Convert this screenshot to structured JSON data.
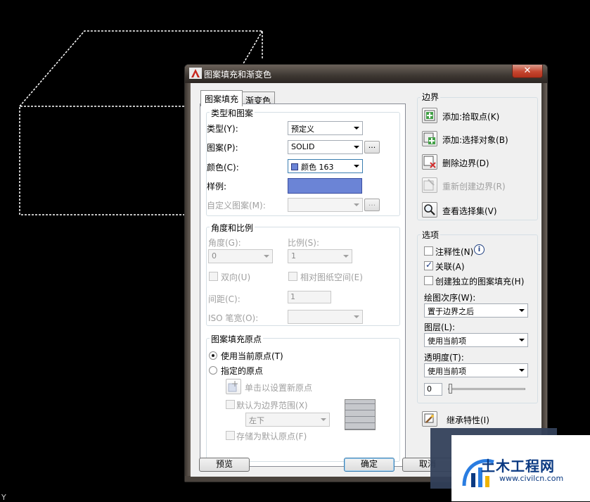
{
  "dialog": {
    "title": "图案填充和渐变色",
    "close_glyph": "✕",
    "tabs": [
      {
        "label": "图案填充",
        "active": true
      },
      {
        "label": "渐变色",
        "active": false
      }
    ],
    "type_pattern": {
      "legend": "类型和图案",
      "type_label": "类型(Y):",
      "type_value": "预定义",
      "pattern_label": "图案(P):",
      "pattern_value": "SOLID",
      "color_label": "颜色(C):",
      "color_value": "颜色 163",
      "sample_label": "样例:",
      "custom_label": "自定义图案(M):",
      "dots": "..."
    },
    "angle_scale": {
      "legend": "角度和比例",
      "angle_label": "角度(G):",
      "angle_value": "0",
      "scale_label": "比例(S):",
      "scale_value": "1",
      "double_label": "双向(U)",
      "relative_label": "相对图纸空间(E)",
      "spacing_label": "间距(C):",
      "spacing_value": "1",
      "iso_label": "ISO 笔宽(O):"
    },
    "origin": {
      "legend": "图案填充原点",
      "use_current_label": "使用当前原点(T)",
      "specified_label": "指定的原点",
      "click_set_label": "单击以设置新原点",
      "default_boundary_label": "默认为边界范围(X)",
      "position_value": "左下",
      "store_default_label": "存储为默认原点(F)"
    },
    "boundary": {
      "title": "边界",
      "add_pick_label": "添加:拾取点(K)",
      "add_select_label": "添加:选择对象(B)",
      "remove_label": "删除边界(D)",
      "recreate_label": "重新创建边界(R)",
      "view_selection_label": "查看选择集(V)"
    },
    "options": {
      "title": "选项",
      "annotative_label": "注释性(N)",
      "associative_label": "关联(A)",
      "separate_label": "创建独立的图案填充(H)",
      "draw_order_label": "绘图次序(W):",
      "draw_order_value": "置于边界之后",
      "layer_label": "图层(L):",
      "layer_value": "使用当前项",
      "transparency_label": "透明度(T):",
      "transparency_value": "使用当前项",
      "transparency_number": "0",
      "info_glyph": "i"
    },
    "inherit_label": "继承特性(I)",
    "buttons": {
      "preview": "预览",
      "ok": "确定",
      "cancel": "取消"
    },
    "colors": {
      "sample": "#6b84d6",
      "title_bar": "#3d3732"
    }
  },
  "canvas": {
    "ucs_label": "Y"
  },
  "watermark": {
    "title": "土木工程网",
    "url": "www.civilcn.com"
  }
}
